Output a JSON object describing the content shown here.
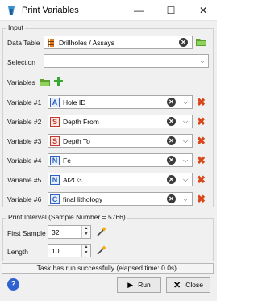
{
  "window": {
    "title": "Print Variables",
    "minimize_glyph": "—",
    "maximize_glyph": "☐",
    "close_glyph": "✕"
  },
  "input": {
    "group_title": "Input",
    "data_table_label": "Data Table",
    "data_table_value": "Drillholes / Assays",
    "data_table_icon": "drillhole-table-icon",
    "selection_label": "Selection",
    "selection_value": ""
  },
  "variables": {
    "label": "Variables",
    "items": [
      {
        "label": "Variable #1",
        "type": "A",
        "value": "Hole ID"
      },
      {
        "label": "Variable #2",
        "type": "S",
        "value": "Depth From"
      },
      {
        "label": "Variable #3",
        "type": "S",
        "value": "Depth To"
      },
      {
        "label": "Variable #4",
        "type": "N",
        "value": "Fe"
      },
      {
        "label": "Variable #5",
        "type": "N",
        "value": "Al2O3"
      },
      {
        "label": "Variable #6",
        "type": "C",
        "value": "final lithology"
      }
    ]
  },
  "print_interval": {
    "group_title": "Print Interval (Sample Number = 5766)",
    "first_sample_label": "First Sample",
    "first_sample_value": "32",
    "length_label": "Length",
    "length_value": "10"
  },
  "status": {
    "message": "Task has run successfully (elapsed time: 0.0s)."
  },
  "footer": {
    "help_glyph": "?",
    "run_label": "Run",
    "close_label": "Close"
  },
  "colors": {
    "accent_blue": "#2d63d1",
    "remove_orange": "#d9481a",
    "folder_green": "#5aa02c"
  }
}
